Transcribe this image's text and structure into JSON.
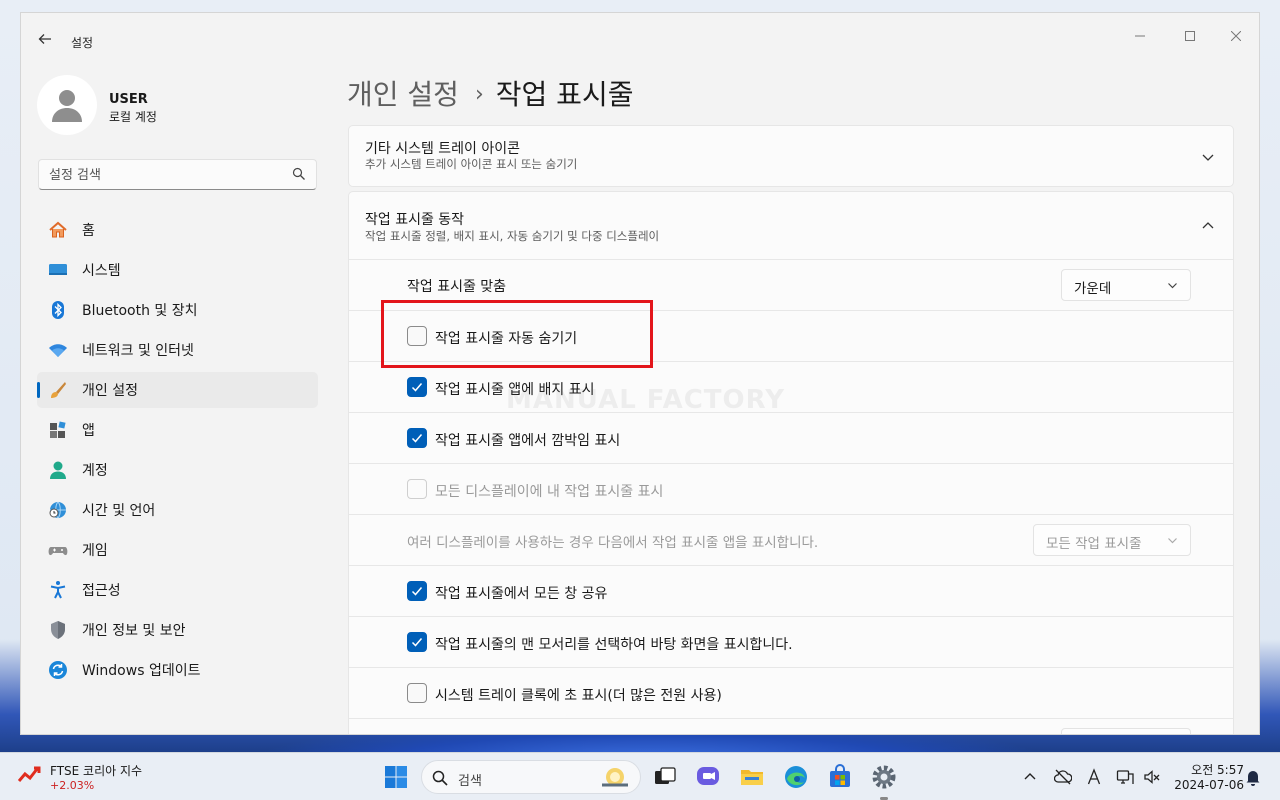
{
  "window": {
    "app_title": "설정"
  },
  "sidebar": {
    "user_name": "USER",
    "user_type": "로컬 계정",
    "search_placeholder": "설정 검색",
    "items": [
      {
        "label": "홈",
        "icon": "home-icon"
      },
      {
        "label": "시스템",
        "icon": "system-icon"
      },
      {
        "label": "Bluetooth 및 장치",
        "icon": "bluetooth-icon"
      },
      {
        "label": "네트워크 및 인터넷",
        "icon": "wifi-icon"
      },
      {
        "label": "개인 설정",
        "icon": "brush-icon",
        "active": true
      },
      {
        "label": "앱",
        "icon": "apps-icon"
      },
      {
        "label": "계정",
        "icon": "account-icon"
      },
      {
        "label": "시간 및 언어",
        "icon": "globe-clock-icon"
      },
      {
        "label": "게임",
        "icon": "gamepad-icon"
      },
      {
        "label": "접근성",
        "icon": "accessibility-icon"
      },
      {
        "label": "개인 정보 및 보안",
        "icon": "shield-icon"
      },
      {
        "label": "Windows 업데이트",
        "icon": "update-icon"
      }
    ]
  },
  "breadcrumb": {
    "parent": "개인 설정",
    "separator": "›",
    "current": "작업 표시줄"
  },
  "tray_icons_card": {
    "title": "기타 시스템 트레이 아이콘",
    "subtitle": "추가 시스템 트레이 아이콘 표시 또는 숨기기"
  },
  "behaviors_card": {
    "title": "작업 표시줄 동작",
    "subtitle": "작업 표시줄 정렬, 배지 표시, 자동 숨기기 및 다중 디스플레이",
    "alignment": {
      "label": "작업 표시줄 맞춤",
      "value": "가운데"
    },
    "options": [
      {
        "label": "작업 표시줄 자동 숨기기",
        "checked": false,
        "disabled": false
      },
      {
        "label": "작업 표시줄 앱에 배지 표시",
        "checked": true,
        "disabled": false
      },
      {
        "label": "작업 표시줄 앱에서 깜박임 표시",
        "checked": true,
        "disabled": false
      },
      {
        "label": "모든 디스플레이에 내 작업 표시줄 표시",
        "checked": false,
        "disabled": true
      }
    ],
    "multi_display": {
      "label": "여러 디스플레이를 사용하는 경우 다음에서 작업 표시줄 앱을 표시합니다.",
      "value": "모든 작업 표시줄"
    },
    "options2": [
      {
        "label": "작업 표시줄에서 모든 창 공유",
        "checked": true
      },
      {
        "label": "작업 표시줄의 맨 모서리를 선택하여 바탕 화면을 표시합니다.",
        "checked": true
      },
      {
        "label": "시스템 트레이 클록에 초 표시(더 많은 전원 사용)",
        "checked": false
      }
    ]
  },
  "watermark": "MANUAL FACTORY",
  "taskbar": {
    "widget_title": "FTSE 코리아 지수",
    "widget_value": "+2.03%",
    "search_text": "검색",
    "time": "오전 5:57",
    "date": "2024-07-06"
  },
  "colors": {
    "accent": "#005fb8",
    "highlight": "#e3151b"
  }
}
